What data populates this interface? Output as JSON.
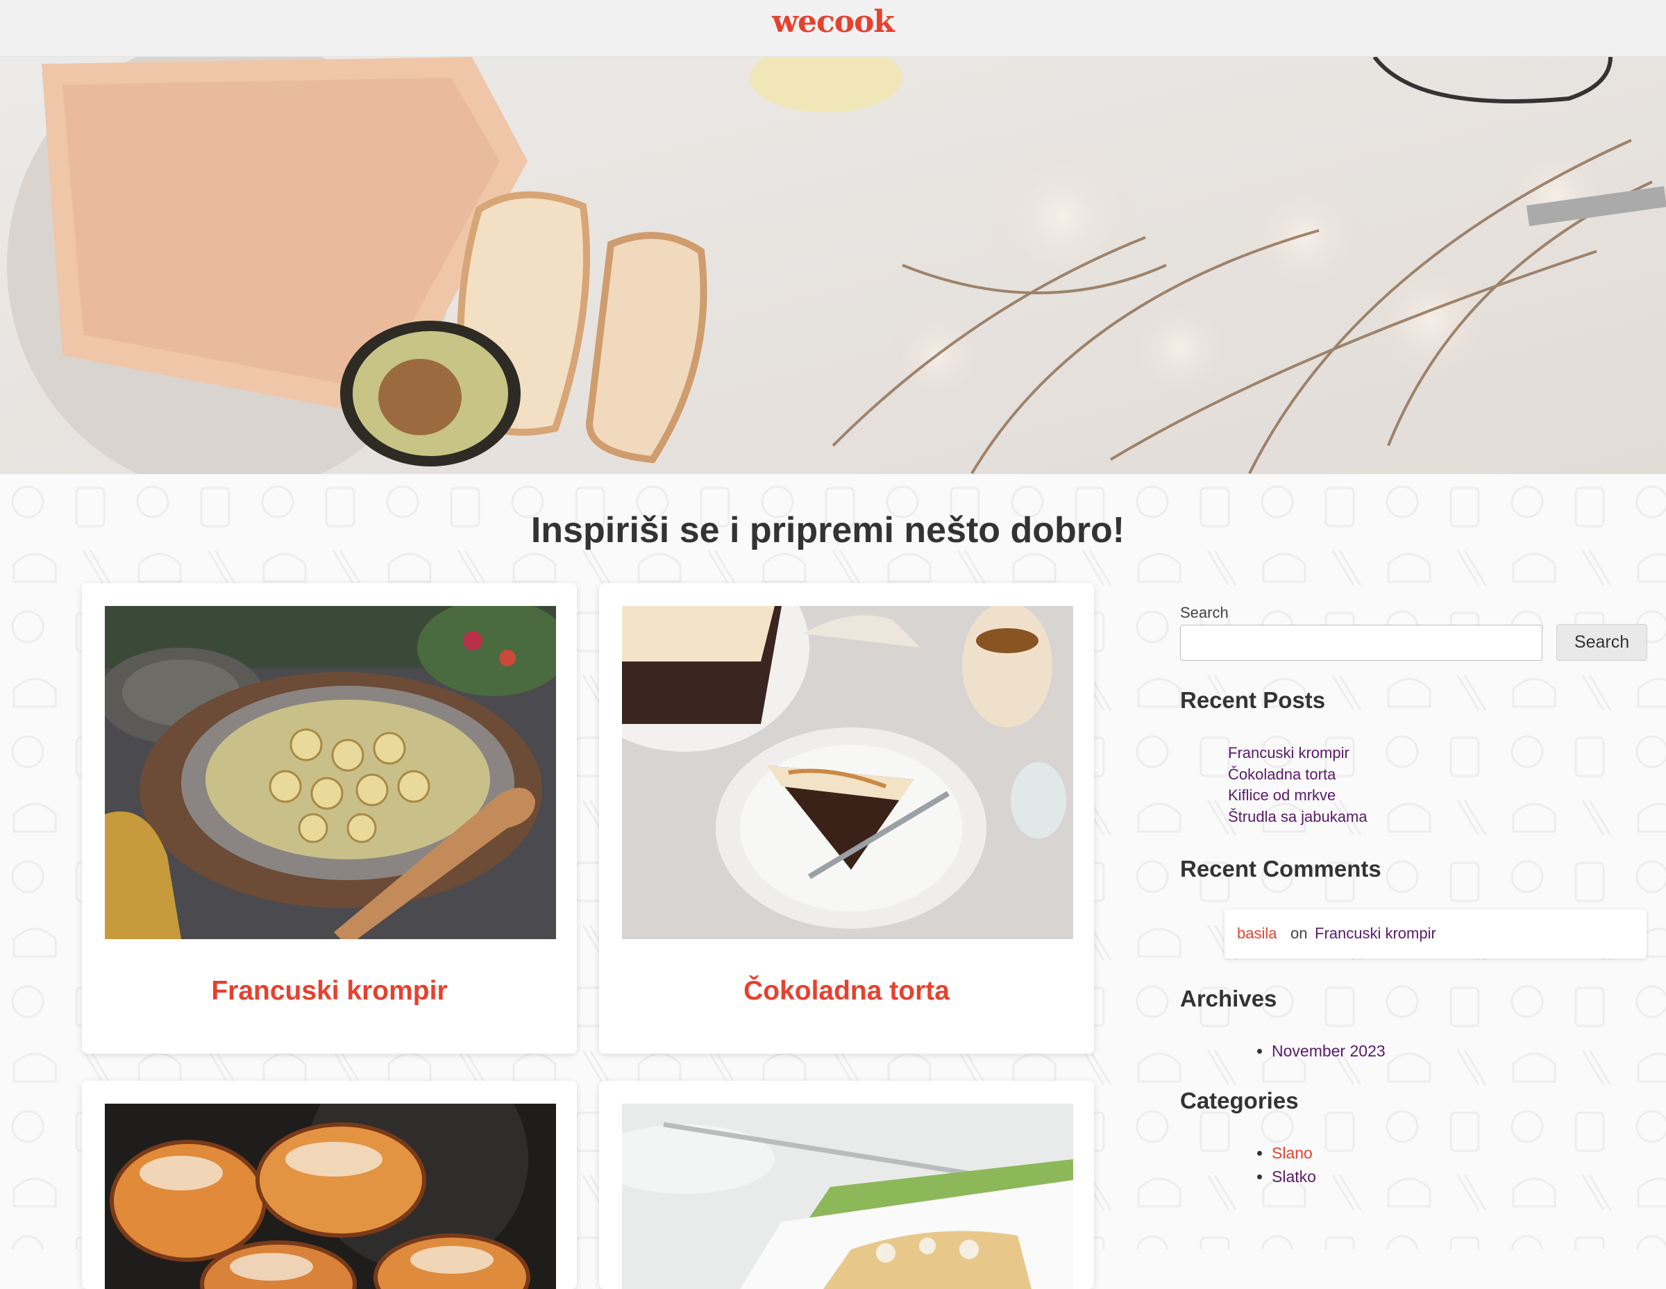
{
  "header": {
    "logo": "wecook"
  },
  "page_title": "Inspiriši se i pripremi nešto dobro!",
  "posts": [
    {
      "title": "Francuski krompir"
    },
    {
      "title": "Čokoladna torta"
    },
    {
      "title": ""
    },
    {
      "title": ""
    }
  ],
  "sidebar": {
    "search": {
      "label": "Search",
      "value": "",
      "button": "Search"
    },
    "recent_posts": {
      "title": "Recent Posts",
      "items": [
        "Francuski krompir",
        "Čokoladna torta",
        "Kiflice od mrkve",
        "Štrudla sa jabukama"
      ]
    },
    "recent_comments": {
      "title": "Recent Comments",
      "author": "basila",
      "on": "on",
      "post": "Francuski krompir"
    },
    "archives": {
      "title": "Archives",
      "items": [
        "November 2023"
      ]
    },
    "categories": {
      "title": "Categories",
      "items": [
        "Slano",
        "Slatko"
      ]
    }
  },
  "colors": {
    "accent": "#e5412f",
    "link": "#5a1a6a",
    "text": "#333333"
  }
}
